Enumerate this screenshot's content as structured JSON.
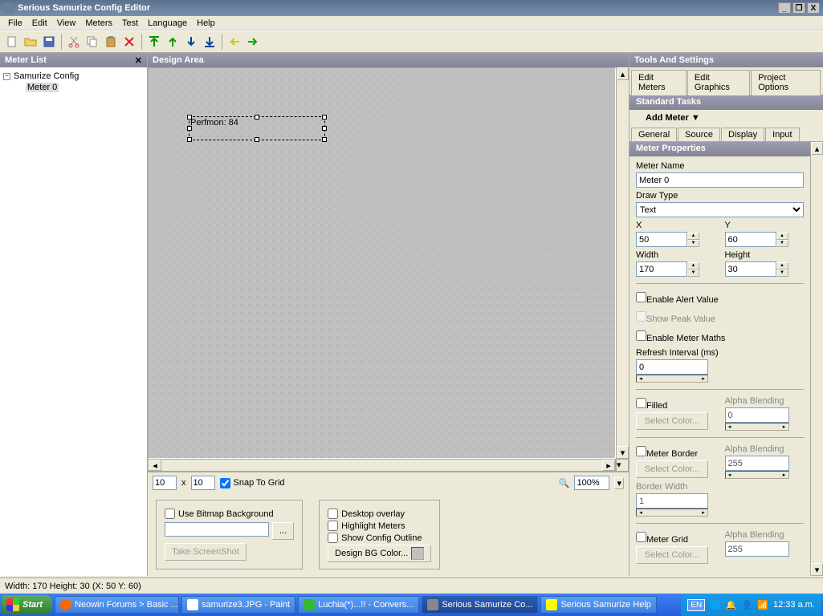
{
  "window": {
    "title": "Serious Samurize Config Editor"
  },
  "menu": {
    "file": "File",
    "edit": "Edit",
    "view": "View",
    "meters": "Meters",
    "test": "Test",
    "language": "Language",
    "help": "Help"
  },
  "panels": {
    "meterList": "Meter List",
    "designArea": "Design Area",
    "tools": "Tools And Settings"
  },
  "tree": {
    "root": "Samurize Config",
    "child": "Meter 0"
  },
  "meter": {
    "text": "Perfmon: 84"
  },
  "designBot": {
    "w": "10",
    "x_label": "x",
    "h": "10",
    "snap": "Snap To Grid",
    "zoom": "100%"
  },
  "opts": {
    "useBitmap": "Use Bitmap Background",
    "browse": "...",
    "screenshot": "Take ScreenShot",
    "desktopOverlay": "Desktop overlay",
    "highlight": "Highlight Meters",
    "showOutline": "Show Config Outline",
    "bgcolor": "Design BG Color..."
  },
  "rightTabs": {
    "editMeters": "Edit Meters",
    "editGraphics": "Edit Graphics",
    "projectOptions": "Project Options"
  },
  "standard": {
    "hdr": "Standard Tasks",
    "addMeter": "Add Meter ▼"
  },
  "subTabs": {
    "general": "General",
    "source": "Source",
    "display": "Display",
    "input": "Input"
  },
  "props": {
    "hdr": "Meter Properties",
    "meterName": "Meter Name",
    "meterNameVal": "Meter 0",
    "drawType": "Draw Type",
    "drawTypeVal": "Text",
    "x": "X",
    "xVal": "50",
    "y": "Y",
    "yVal": "60",
    "width": "Width",
    "widthVal": "170",
    "height": "Height",
    "heightVal": "30",
    "enableAlert": "Enable Alert Value",
    "showPeak": "Show Peak Value",
    "enableMaths": "Enable Meter Maths",
    "refresh": "Refresh Interval (ms)",
    "refreshVal": "0",
    "filled": "Filled",
    "alphaBlend": "Alpha Blending",
    "alpha0": "0",
    "selectColor": "Select Color...",
    "meterBorder": "Meter Border",
    "alpha255": "255",
    "borderWidth": "Border Width",
    "borderWidthVal": "1",
    "meterGrid": "Meter Grid"
  },
  "status": {
    "text": "Width: 170  Height: 30  (X: 50  Y: 60)"
  },
  "taskbar": {
    "start": "Start",
    "items": [
      "Neowin Forums > Basic ...",
      "samurize3.JPG - Paint",
      "Luchia(*)...!! - Convers...",
      "Serious Samurize Co...",
      "Serious Samurize Help"
    ],
    "lang": "EN",
    "time": "12:33 a.m."
  }
}
